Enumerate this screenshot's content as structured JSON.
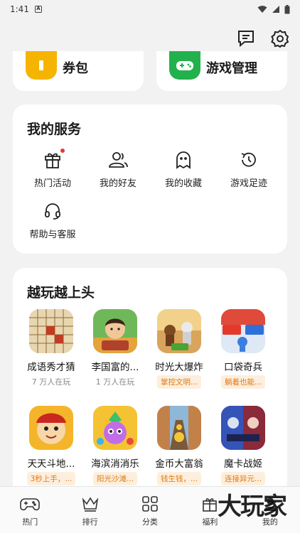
{
  "statusbar": {
    "time": "1:41",
    "sim_letter": "A"
  },
  "top_cards": [
    {
      "label": "券包",
      "color": "#f5b400",
      "icon": "ticket-icon"
    },
    {
      "label": "游戏管理",
      "color": "#22b14c",
      "icon": "gamepad-icon"
    }
  ],
  "services": {
    "title": "我的服务",
    "items": [
      {
        "label": "热门活动",
        "icon": "gift-icon"
      },
      {
        "label": "我的好友",
        "icon": "friends-icon"
      },
      {
        "label": "我的收藏",
        "icon": "ghost-icon"
      },
      {
        "label": "游戏足迹",
        "icon": "history-icon"
      },
      {
        "label": "帮助与客服",
        "icon": "headset-icon"
      }
    ]
  },
  "games": {
    "title": "越玩越上头",
    "items": [
      {
        "name": "成语秀才猜",
        "sub": "7 万人在玩",
        "tag": ""
      },
      {
        "name": "李国富的...",
        "sub": "1 万人在玩",
        "tag": ""
      },
      {
        "name": "时光大爆炸",
        "sub": "",
        "tag": "掌控文明..."
      },
      {
        "name": "口袋奇兵",
        "sub": "",
        "tag": "躺着也能..."
      },
      {
        "name": "天天斗地...",
        "sub": "",
        "tag": "3秒上手，..."
      },
      {
        "name": "海滨消消乐",
        "sub": "",
        "tag": "阳光沙滩..."
      },
      {
        "name": "金币大富翁",
        "sub": "",
        "tag": "钱生钱，..."
      },
      {
        "name": "魔卡战姬",
        "sub": "",
        "tag": "连接异元..."
      }
    ]
  },
  "tabs": [
    {
      "label": "热门",
      "icon": "gamepad-icon"
    },
    {
      "label": "排行",
      "icon": "crown-icon"
    },
    {
      "label": "分类",
      "icon": "grid-icon"
    },
    {
      "label": "福利",
      "icon": "gift-box-icon"
    },
    {
      "label": "我的",
      "icon": "profile-icon"
    }
  ],
  "watermark": "大玩家",
  "colors": {
    "tag_text": "#e07a10",
    "tag_bg": "#fdeedd",
    "badge": "#e53935"
  }
}
